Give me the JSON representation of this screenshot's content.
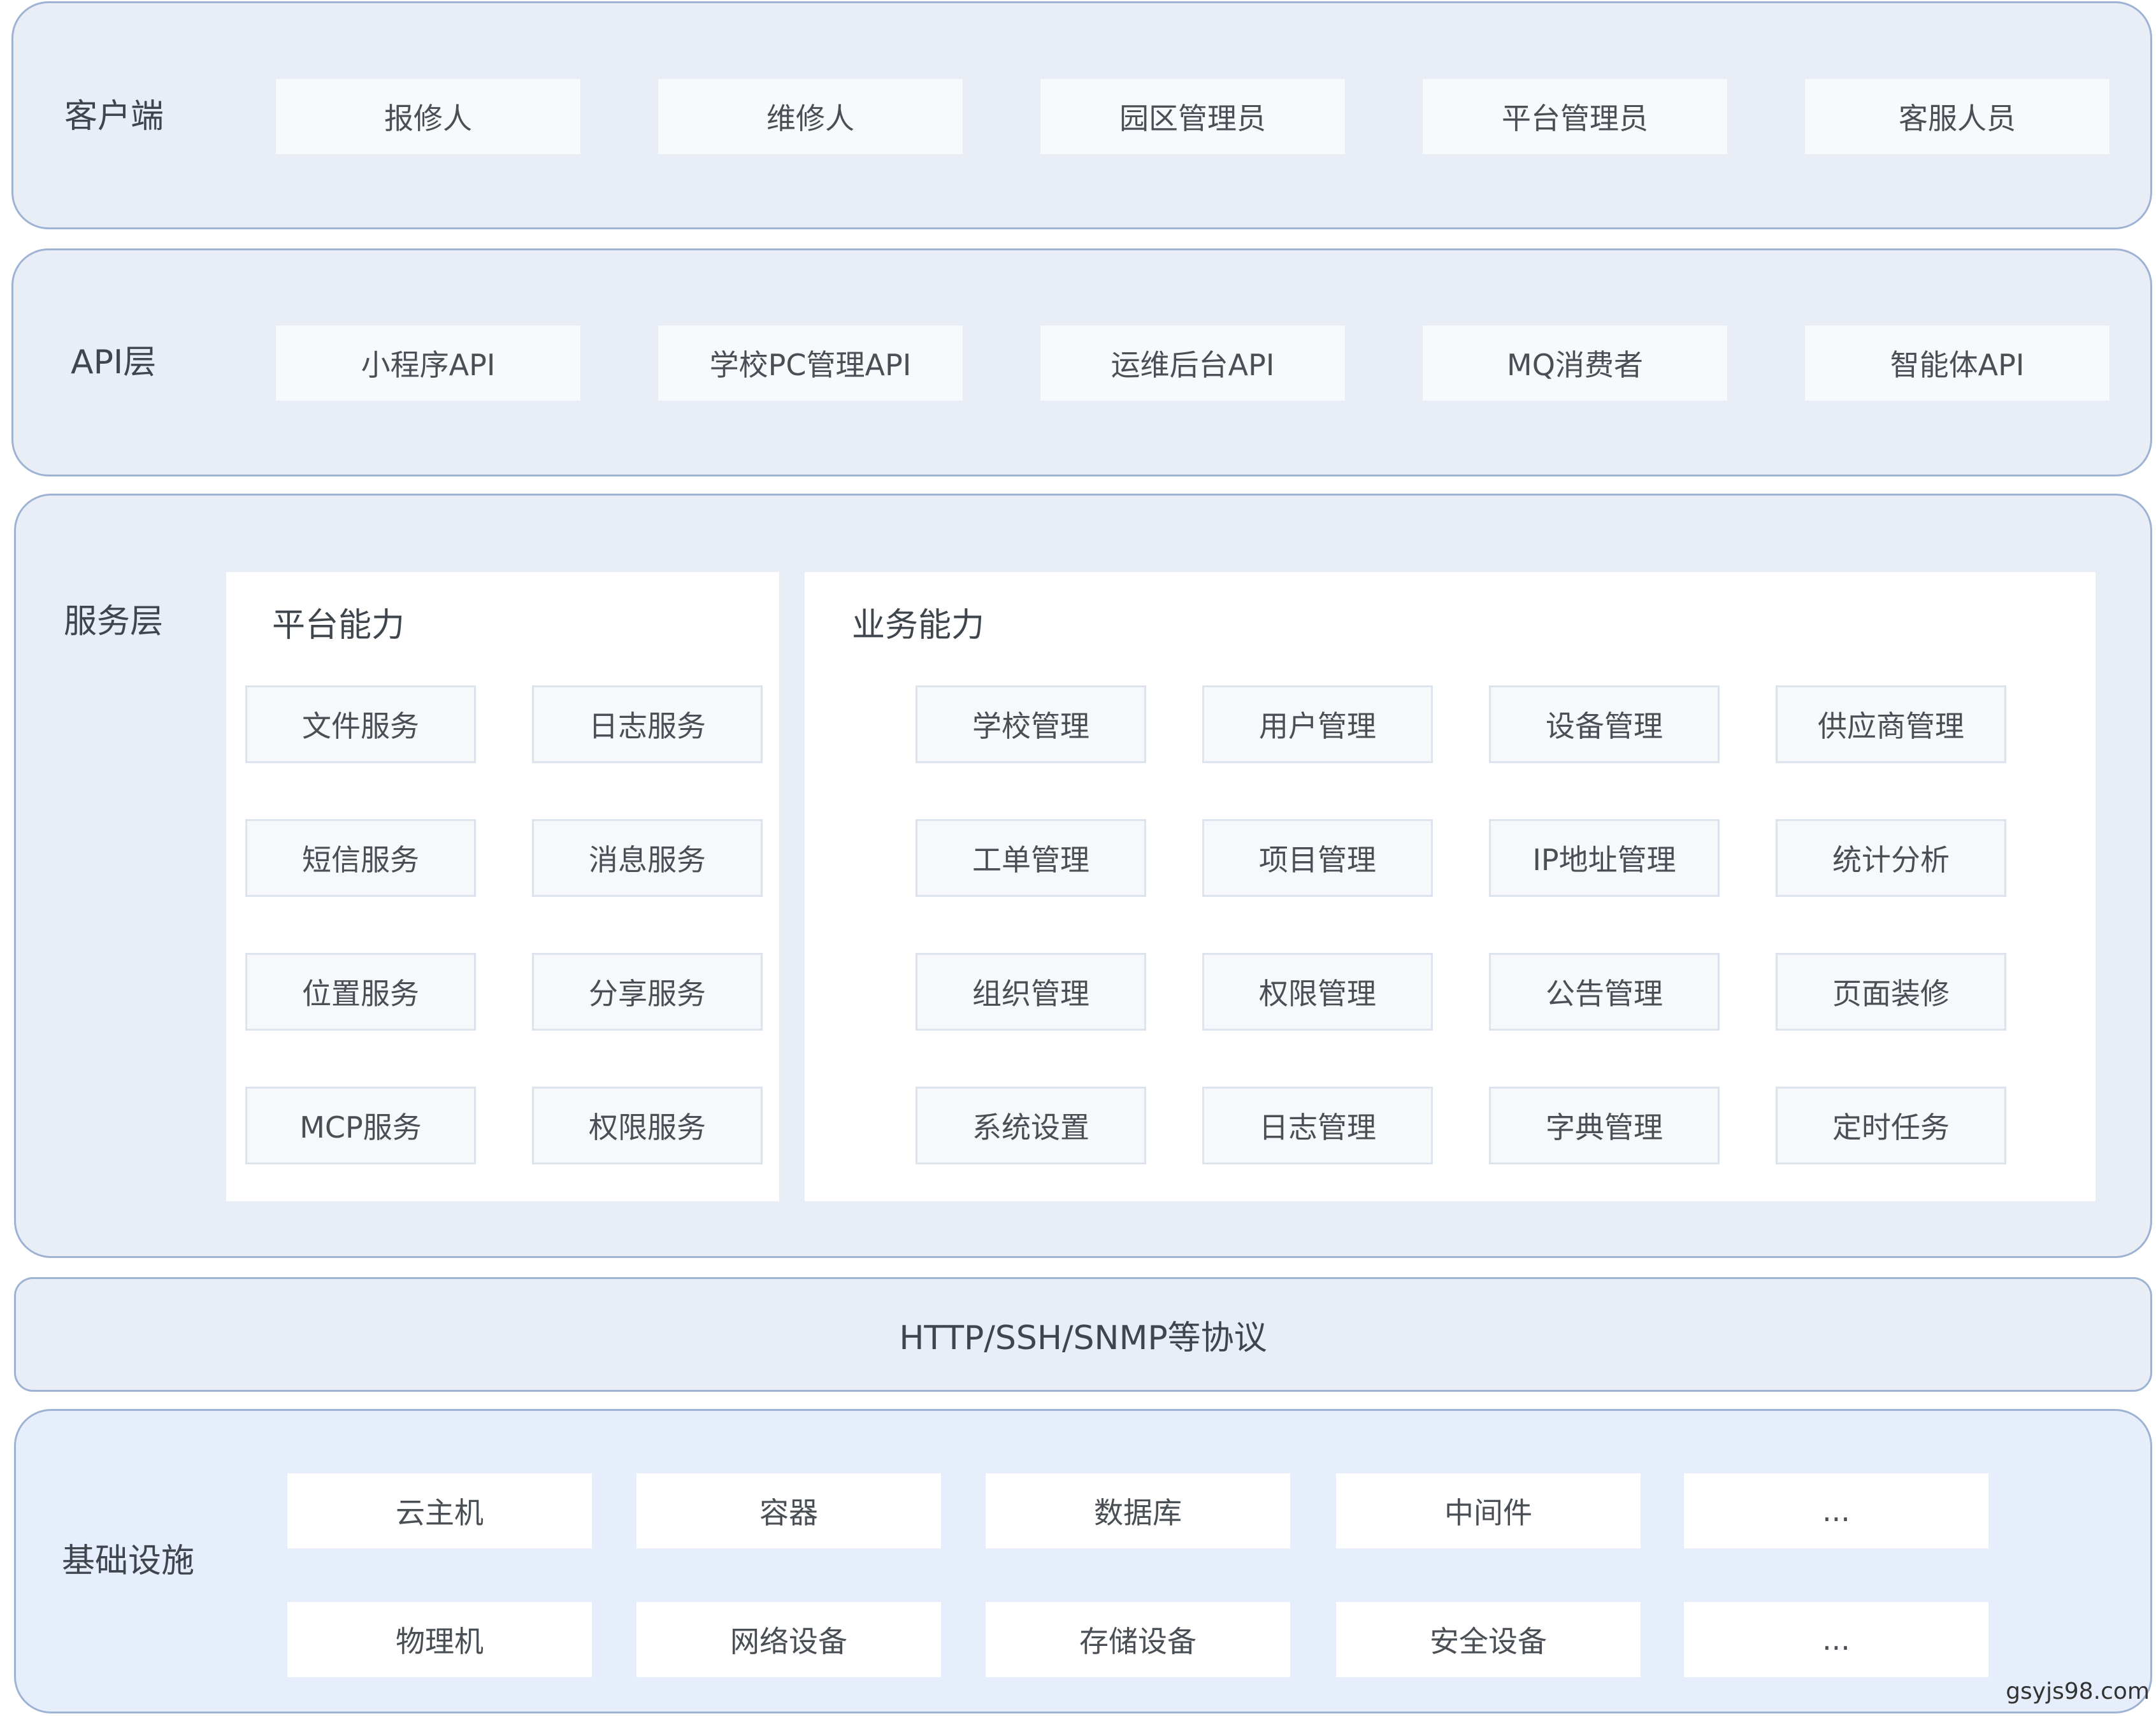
{
  "client_layer": {
    "title": "客户端",
    "items": [
      "报修人",
      "维修人",
      "园区管理员",
      "平台管理员",
      "客服人员"
    ]
  },
  "api_layer": {
    "title": "API层",
    "items": [
      "小程序API",
      "学校PC管理API",
      "运维后台API",
      "MQ消费者",
      "智能体API"
    ]
  },
  "service_layer": {
    "title": "服务层",
    "platform": {
      "title": "平台能力",
      "items": [
        "文件服务",
        "日志服务",
        "短信服务",
        "消息服务",
        "位置服务",
        "分享服务",
        "MCP服务",
        "权限服务"
      ]
    },
    "business": {
      "title": "业务能力",
      "items": [
        "学校管理",
        "用户管理",
        "设备管理",
        "供应商管理",
        "工单管理",
        "项目管理",
        "IP地址管理",
        "统计分析",
        "组织管理",
        "权限管理",
        "公告管理",
        "页面装修",
        "系统设置",
        "日志管理",
        "字典管理",
        "定时任务"
      ]
    }
  },
  "protocol_layer": {
    "label": "HTTP/SSH/SNMP等协议"
  },
  "infra_layer": {
    "title": "基础设施",
    "items": [
      "云主机",
      "容器",
      "数据库",
      "中间件",
      "...",
      "物理机",
      "网络设备",
      "存储设备",
      "安全设备",
      "..."
    ]
  },
  "watermark": "gsyjs98.com"
}
